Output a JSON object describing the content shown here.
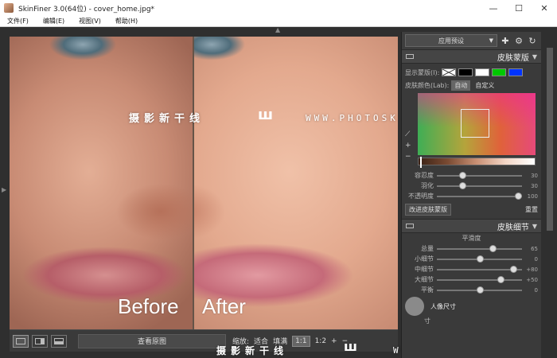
{
  "window": {
    "title": "SkinFiner 3.0(64位) - cover_home.jpg*",
    "min": "—",
    "max": "☐",
    "close": "✕"
  },
  "menu": [
    "文件(F)",
    "编辑(E)",
    "视图(V)",
    "帮助(H)"
  ],
  "canvas": {
    "before_label": "Before",
    "after_label": "After",
    "watermark_cn": "摄影新干线",
    "watermark_url": "WWW.PHOTOSKS.VIP",
    "watermark_logo": "ш"
  },
  "bottombar": {
    "view_original": "查看原图",
    "zoom_label": "缩放:",
    "fit": "适合",
    "fill": "填满",
    "one_to_one": "1:1",
    "one_to_two": "1:2",
    "plus": "+",
    "minus": "−"
  },
  "panel": {
    "preset": "应用预设",
    "skin_mask": {
      "title": "皮肤蒙版",
      "show_mask": "显示蒙版(I):",
      "swatches": [
        "#ffffff",
        "#000000",
        "#ffffff",
        "#00c800",
        "#0033ff"
      ],
      "skin_color": "皮肤颜色(Lab):",
      "auto": "自动",
      "custom": "自定义",
      "sliders": [
        {
          "label": "容忍度",
          "value": 30,
          "max": 100
        },
        {
          "label": "羽化",
          "value": 30,
          "max": 100
        },
        {
          "label": "不透明度",
          "value": 100,
          "max": 100
        }
      ],
      "improve": "改进皮肤蒙版",
      "reset": "重置"
    },
    "skin_detail": {
      "title": "皮肤细节",
      "smoothness": "平滑度",
      "sliders": [
        {
          "label": "总量",
          "value": 65,
          "display": "65",
          "min": 0,
          "max": 100
        },
        {
          "label": "小细节",
          "value": 0,
          "display": "0",
          "min": -100,
          "max": 100
        },
        {
          "label": "中细节",
          "value": 80,
          "display": "+80",
          "min": -100,
          "max": 100
        },
        {
          "label": "大细节",
          "value": 50,
          "display": "+50",
          "min": -100,
          "max": 100
        },
        {
          "label": "平衡",
          "value": 0,
          "display": "0",
          "min": -100,
          "max": 100
        }
      ],
      "portrait_size": "人像尺寸",
      "size_tail": "寸"
    }
  }
}
